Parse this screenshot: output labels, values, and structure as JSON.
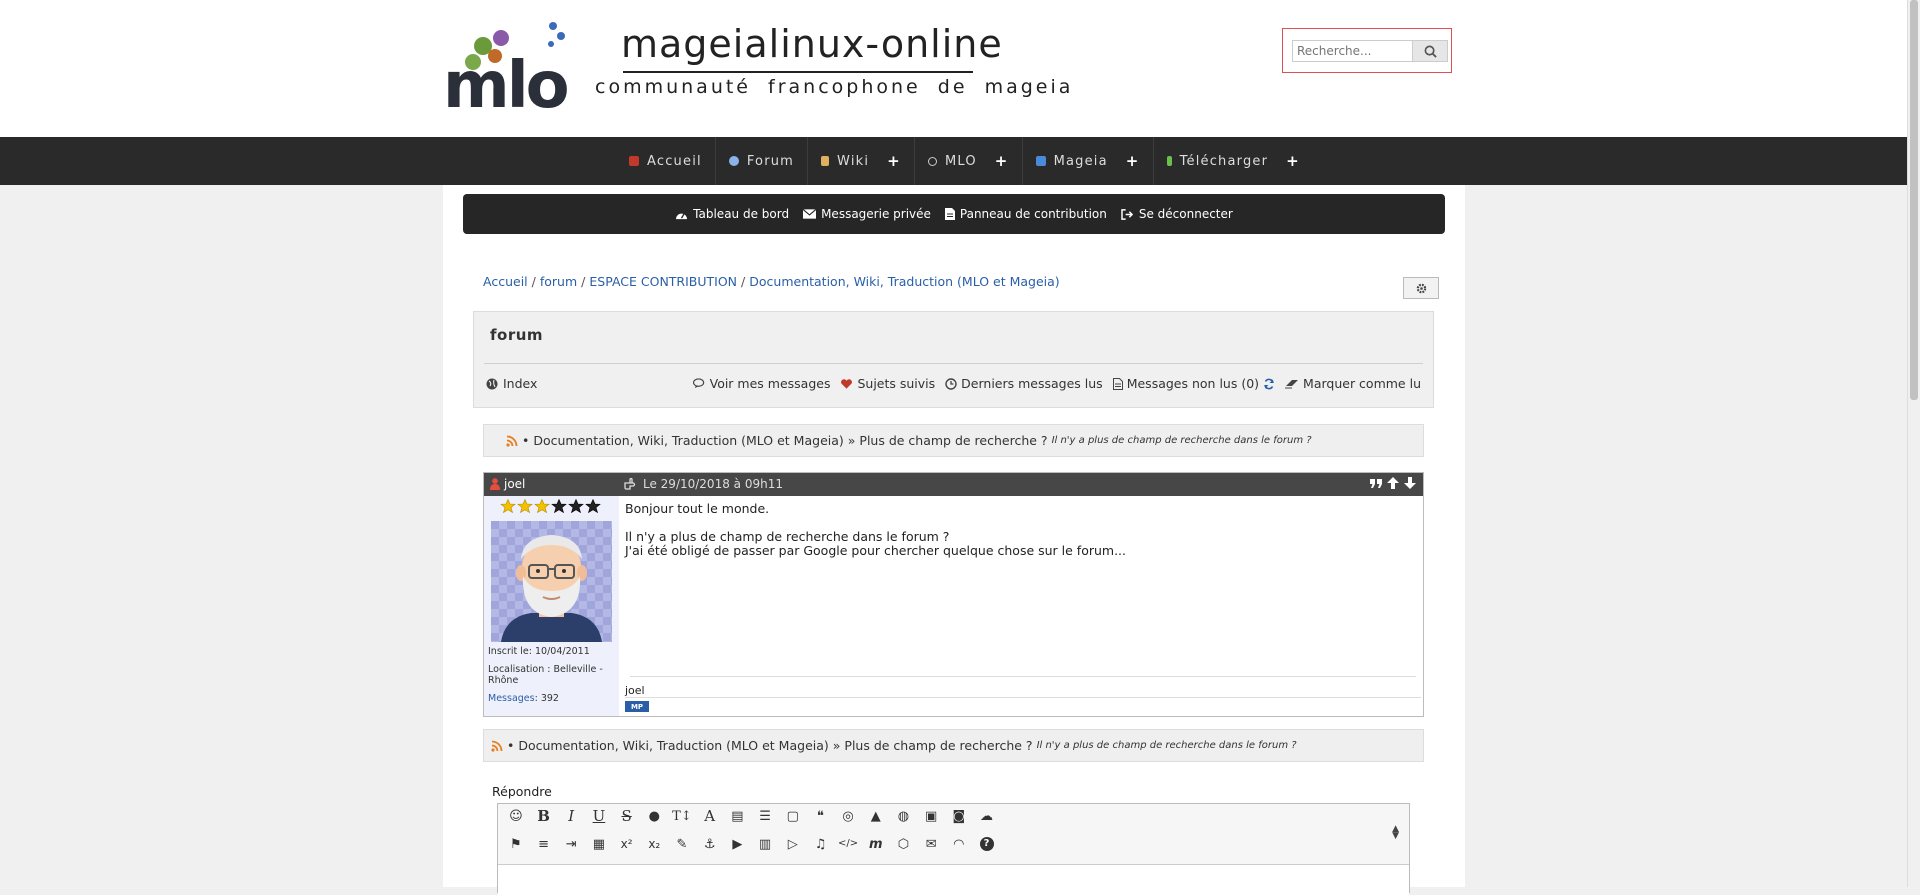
{
  "header": {
    "logo": {
      "mark": "mlo",
      "title": "mageialinux-online",
      "subtitle": "communauté francophone de mageia"
    },
    "search": {
      "placeholder": "Recherche...",
      "icon": "search-icon"
    }
  },
  "main_nav": {
    "items": [
      {
        "label": "Accueil",
        "icon": "home-icon",
        "icon_color": "#c0392b",
        "has_submenu": false
      },
      {
        "label": "Forum",
        "icon": "globe-icon",
        "icon_color": "#8ab4e8",
        "has_submenu": false
      },
      {
        "label": "Wiki",
        "icon": "book-icon",
        "icon_color": "#e0b060",
        "has_submenu": true
      },
      {
        "label": "MLO",
        "icon": "apple-icon",
        "icon_color": "#cccccc",
        "has_submenu": true
      },
      {
        "label": "Mageia",
        "icon": "mageia-icon",
        "icon_color": "#4a8ad8",
        "has_submenu": true
      },
      {
        "label": "Télécharger",
        "icon": "download-icon",
        "icon_color": "#6ac04a",
        "has_submenu": true
      }
    ],
    "submenu_glyph": "+"
  },
  "user_bar": {
    "items": [
      {
        "label": "Tableau de bord",
        "icon": "dashboard-icon"
      },
      {
        "label": "Messagerie privée",
        "icon": "envelope-icon"
      },
      {
        "label": "Panneau de contribution",
        "icon": "file-icon"
      },
      {
        "label": "Se déconnecter",
        "icon": "sign-out-icon"
      }
    ]
  },
  "breadcrumb": {
    "items": [
      "Accueil",
      "forum",
      "ESPACE CONTRIBUTION",
      "Documentation, Wiki, Traduction (MLO et Mageia)"
    ],
    "separator": "/"
  },
  "forum": {
    "title": "forum",
    "index_label": "Index",
    "links": [
      {
        "label": "Voir mes messages",
        "icon": "comments-icon"
      },
      {
        "label": "Sujets suivis",
        "icon": "heart-icon"
      },
      {
        "label": "Derniers messages lus",
        "icon": "clock-icon"
      },
      {
        "label": "Messages non lus (0)",
        "icon": "document-icon"
      },
      {
        "label": "Marquer comme lu",
        "icon": "eraser-icon"
      }
    ]
  },
  "topic": {
    "bullet": "•",
    "category": "Documentation, Wiki, Traduction (MLO et Mageia)",
    "arrow": "»",
    "title": "Plus de champ de recherche ?",
    "description": "Il n'y a plus de champ de recherche dans le forum ?"
  },
  "post": {
    "author": "joel",
    "date": "Le 29/10/2018 à 09h11",
    "stars_filled": 3,
    "stars_total": 6,
    "registered": "Inscrit le: 10/04/2011",
    "location": "Localisation : Belleville - Rhône",
    "messages_label": "Messages",
    "messages_count": ": 392",
    "body": [
      "Bonjour tout le monde.",
      "",
      "Il n'y a plus de champ de recherche dans le forum ?",
      "J'ai été obligé de passer par Google pour chercher quelque chose sur le forum..."
    ],
    "signature": "joel",
    "mp_badge": "MP",
    "actions": [
      "quote-icon",
      "arrow-up-icon",
      "arrow-down-icon"
    ]
  },
  "reply": {
    "label": "Répondre",
    "toolbar_row1": [
      "smiley-icon",
      "bold-icon",
      "italic-icon",
      "underline-icon",
      "strikethrough-icon",
      "color-drop-icon",
      "text-size-icon",
      "font-icon",
      "align-block-icon",
      "list-icon",
      "box-icon",
      "blockquote-icon",
      "hide-icon",
      "warning-icon",
      "link-icon",
      "image-icon",
      "camera-icon",
      "cloud-upload-icon"
    ],
    "toolbar_row2": [
      "flag-icon",
      "align-left-icon",
      "indent-icon",
      "table-icon",
      "superscript-icon",
      "subscript-icon",
      "brush-icon",
      "anchor-icon",
      "play-icon",
      "film-icon",
      "youtube-icon",
      "music-icon",
      "code-icon",
      "mail-m-icon",
      "html5-icon",
      "envelope-icon",
      "rss-icon",
      "help-icon"
    ]
  }
}
